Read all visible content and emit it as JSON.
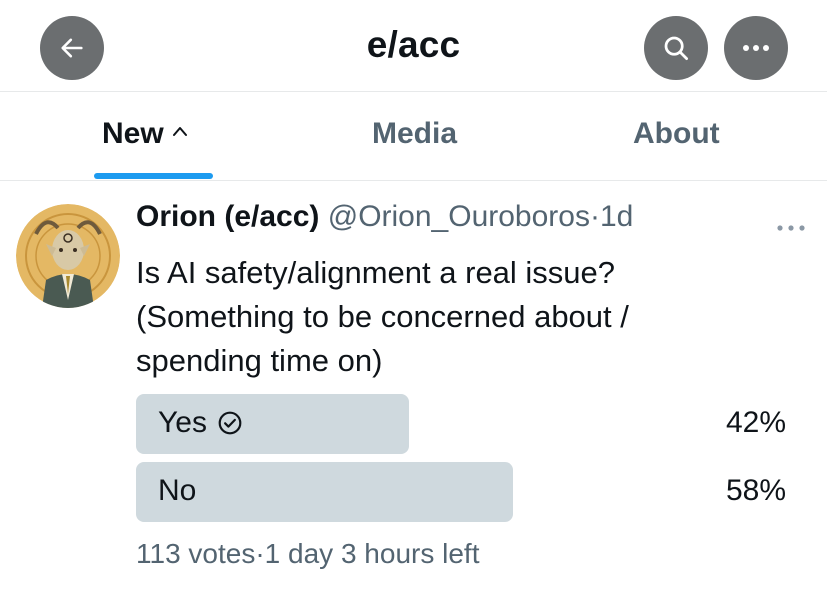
{
  "header": {
    "title": "e/acc",
    "back_icon": "arrow-left-icon",
    "search_icon": "search-icon",
    "more_icon": "more-horizontal-icon"
  },
  "tabs": [
    {
      "label": "New",
      "active": true,
      "icon": "chevron-up-icon"
    },
    {
      "label": "Media",
      "active": false
    },
    {
      "label": "About",
      "active": false
    }
  ],
  "post": {
    "author_name": "Orion (e/acc)",
    "handle": "@Orion_Ouroboros",
    "separator": "·",
    "age": "1d",
    "text_lines": [
      "Is AI safety/alignment a real issue?",
      "(Something to be concerned about /",
      "spending time on)"
    ],
    "poll": {
      "options": [
        {
          "label": "Yes",
          "percent": "42%",
          "fraction": 0.42,
          "selected": true
        },
        {
          "label": "No",
          "percent": "58%",
          "fraction": 0.58,
          "selected": false
        }
      ],
      "votes": "113 votes",
      "time_left": "1 day 3 hours left"
    }
  },
  "colors": {
    "accent": "#1d9bf0",
    "muted_text": "#536471",
    "poll_bar": "#cfd9de",
    "header_button": "#6b6e70"
  }
}
